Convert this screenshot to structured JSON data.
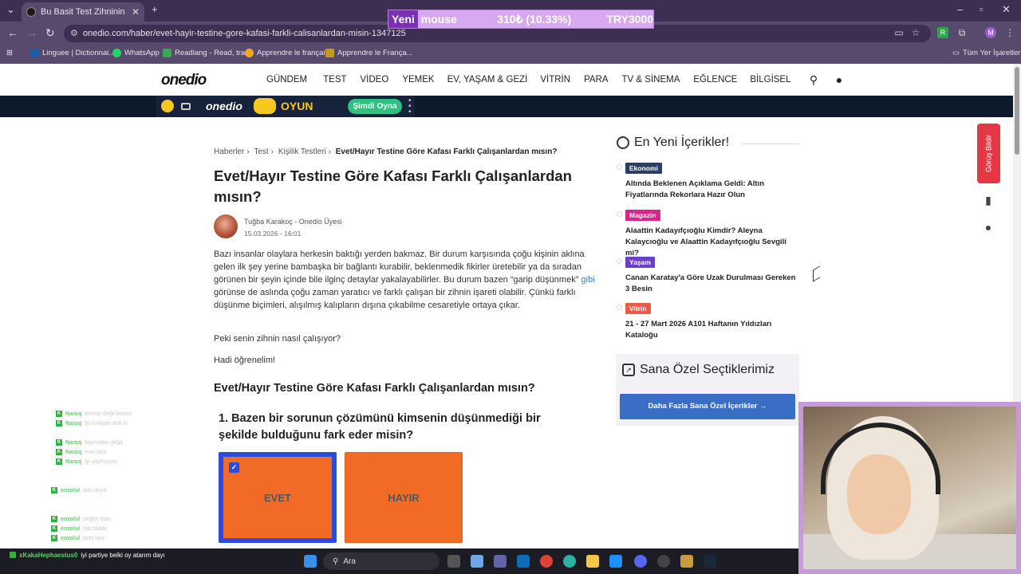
{
  "browser": {
    "tab_title": "Bu Basit Test Zihninin Nasıl Çalı",
    "url": "onedio.com/haber/evet-hayir-testine-gore-kafasi-farkli-calisanlardan-misin-1347125",
    "bookmarks": [
      "Linguee | Dictionnai...",
      "WhatsApp",
      "Readlang - Read, tra...",
      "Apprendre le français",
      "Apprendre le França..."
    ],
    "all_bookmarks": "Tüm Yer İşaretleri",
    "profile_initial": "M"
  },
  "ticker": {
    "label": "Yeni",
    "item": "mouse",
    "price": "310₺ (10.33%)",
    "total": "TRY3000"
  },
  "site": {
    "logo": "onedio",
    "nav": [
      "GÜNDEM",
      "TEST",
      "VİDEO",
      "YEMEK",
      "EV, YAŞAM & GEZİ",
      "VİTRİN",
      "PARA",
      "TV & SİNEMA",
      "EĞLENCE",
      "BİLGİSEL"
    ],
    "game_bar": {
      "logo": "onedio",
      "word": "OYUN",
      "button": "Şimdi Oyna"
    }
  },
  "article": {
    "breadcrumb": [
      "Haberler",
      "Test",
      "Kişilik Testleri",
      "Evet/Hayır Testine Göre Kafası Farklı Çalışanlardan mısın?"
    ],
    "title": "Evet/Hayır Testine Göre Kafası Farklı Çalışanlardan mısın?",
    "author": "Tuğba Karakoç",
    "author_role": "- Onedio Üyesi",
    "date": "15.03.2026 - 16:01",
    "intro_a": "Bazı insanlar olaylara herkesin baktığı yerden bakmaz. Bir durum karşısında çoğu kişinin aklına gelen ilk şey yerine bambaşka bir bağlantı kurabilir, beklenmedik fikirler üretebilir ya da sıradan görünen bir şeyin içinde bile ilginç detaylar yakalayabilirler. Bu durum bazen “garip düşünmek”",
    "intro_link": "gibi",
    "intro_b": "görünse de aslında çoğu zaman yaratıcı ve farklı çalışan bir zihnin işareti olabilir. Çünkü farklı düşünme biçimleri, alışılmış kalıpların dışına çıkabilme cesaretiyle ortaya çıkar.",
    "para1": "Peki senin zihnin nasıl çalışıyor?",
    "para2": "Hadi öğrenelim!",
    "section_title": "Evet/Hayır Testine Göre Kafası Farklı Çalışanlardan mısın?",
    "question": "1. Bazen bir sorunun çözümünü kimsenin düşünmediği bir şekilde bulduğunu fark eder misin?",
    "answers": [
      "EVET",
      "HAYIR"
    ],
    "selected_answer": "EVET"
  },
  "sidebar": {
    "heading": "En Yeni İçerikler!",
    "items": [
      {
        "badge": "Ekonomi",
        "color": "#2d3e66",
        "title": "Altında Beklenen Açıklama Geldi: Altın Fiyatlarında Rekorlara Hazır Olun"
      },
      {
        "badge": "Magazin",
        "color": "#d9258b",
        "title": "Alaattin Kadayıfçıoğlu Kimdir? Aleyna Kalaycıoğlu ve Alaattin Kadayıfçıoğlu Sevgili mi?"
      },
      {
        "badge": "Yaşam",
        "color": "#6b3fc9",
        "title": "Canan Karatay'a Göre Uzak Durulması Gereken 3 Besin"
      },
      {
        "badge": "Vitrin",
        "color": "#ea5b4a",
        "title": "21 - 27 Mart 2026 A101 Haftanın Yıldızları Kataloğu"
      }
    ],
    "ozel_heading": "Sana Özel Seçtiklerimiz",
    "ozel_button": "Daha Fazla Sana Özel İçerikler →"
  },
  "floating": {
    "feedback": "Görüş Bildir"
  },
  "chat": {
    "rows": [
      {
        "user": "Naroq",
        "msg": "kırmızı değil bence"
      },
      {
        "user": "Naroq",
        "msg": "bu kolaydı ekle ki"
      },
      {
        "user": "Naroq",
        "msg": "kaçmadın değil"
      },
      {
        "user": "Naroq",
        "msg": "evet bea"
      },
      {
        "user": "Naroq",
        "msg": "iyi yapmışsın"
      },
      {
        "user": "enzolul",
        "msg": "laal oluyo"
      },
      {
        "user": "enzolul",
        "msg": "değen olan"
      },
      {
        "user": "enzolul",
        "msg": "hacıdoldu"
      },
      {
        "user": "enzolul",
        "msg": "evet bea"
      }
    ],
    "bottom_user": "xKakaHephaestus0",
    "bottom_msg": "iyi partiye belki oy atarım dayı"
  },
  "taskbar": {
    "search": "Ara"
  }
}
